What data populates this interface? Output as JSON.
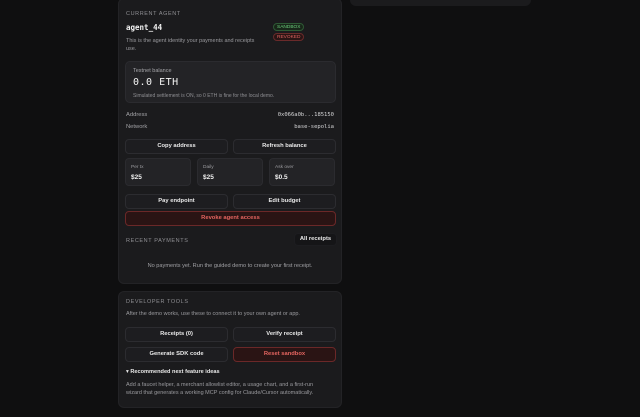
{
  "agent_card": {
    "section_label": "CURRENT AGENT",
    "agent_name": "agent_44",
    "badges": {
      "sandbox": "SANDBOX",
      "revoked": "REVOKED"
    },
    "description_line1": "This is the agent identity your payments and receipts",
    "description_line2": "use.",
    "balance": {
      "label": "Testnet balance",
      "value": "0.0 ETH",
      "note": "Simulated settlement is ON, so 0 ETH is fine for the local demo."
    },
    "address_label": "Address",
    "address_value": "0x066a0b...185150",
    "network_label": "Network",
    "network_value": "base-sepolia",
    "buttons": {
      "copy_address": "Copy address",
      "refresh_balance": "Refresh balance",
      "pay_endpoint": "Pay endpoint",
      "edit_budget": "Edit budget",
      "revoke": "Revoke agent access"
    },
    "stats": [
      {
        "label": "Per tx",
        "value": "$25"
      },
      {
        "label": "Daily",
        "value": "$25"
      },
      {
        "label": "Ask over",
        "value": "$0.5"
      }
    ],
    "recent_payments_label": "RECENT PAYMENTS",
    "all_receipts": "All receipts",
    "empty_message": "No payments yet. Run the guided demo to create your first receipt."
  },
  "dev_card": {
    "section_label": "DEVELOPER TOOLS",
    "description": "After the demo works, use these to connect it to your own agent or app.",
    "buttons": {
      "receipts": "Receipts (0)",
      "verify_receipt": "Verify receipt",
      "generate_sdk": "Generate SDK code",
      "reset_sandbox": "Reset sandbox"
    },
    "ideas_toggle_icon": "triangle-down-icon",
    "ideas_title": "Recommended next feature ideas",
    "ideas_line1": "Add a faucet helper, a merchant allowlist editor, a usage chart, and a first-run",
    "ideas_line2": "wizard that generates a working MCP config for Claude/Cursor automatically."
  },
  "colors": {
    "background": "#0f0f10",
    "card": "#1b1b1d",
    "sandbox_green": "#6ccf7d",
    "danger_red": "#e56560"
  }
}
